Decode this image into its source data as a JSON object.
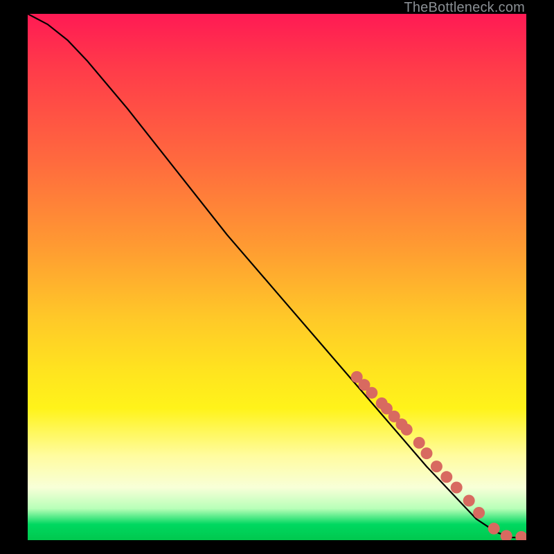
{
  "watermark": "TheBottleneck.com",
  "chart_data": {
    "type": "line",
    "title": "",
    "xlabel": "",
    "ylabel": "",
    "xlim": [
      0,
      100
    ],
    "ylim": [
      0,
      100
    ],
    "grid": false,
    "series": [
      {
        "name": "curve",
        "style": "line",
        "color": "#000000",
        "x": [
          0,
          4,
          8,
          12,
          20,
          30,
          40,
          50,
          60,
          70,
          80,
          86,
          90,
          94,
          97,
          100
        ],
        "y": [
          100,
          98,
          95,
          91,
          82,
          70,
          58,
          47,
          36,
          25,
          14,
          8,
          4,
          1.5,
          0.5,
          0.5
        ]
      },
      {
        "name": "highlight-points",
        "style": "marker",
        "color": "#d86a60",
        "x": [
          66,
          67.5,
          69,
          71,
          72,
          73.5,
          75,
          76,
          78.5,
          80,
          82,
          84,
          86,
          88.5,
          90.5,
          93.5,
          96,
          99
        ],
        "y": [
          31,
          29.5,
          28,
          26,
          25,
          23.5,
          22,
          21,
          18.5,
          16.5,
          14,
          12,
          10,
          7.5,
          5.2,
          2.2,
          0.8,
          0.6
        ]
      }
    ]
  }
}
